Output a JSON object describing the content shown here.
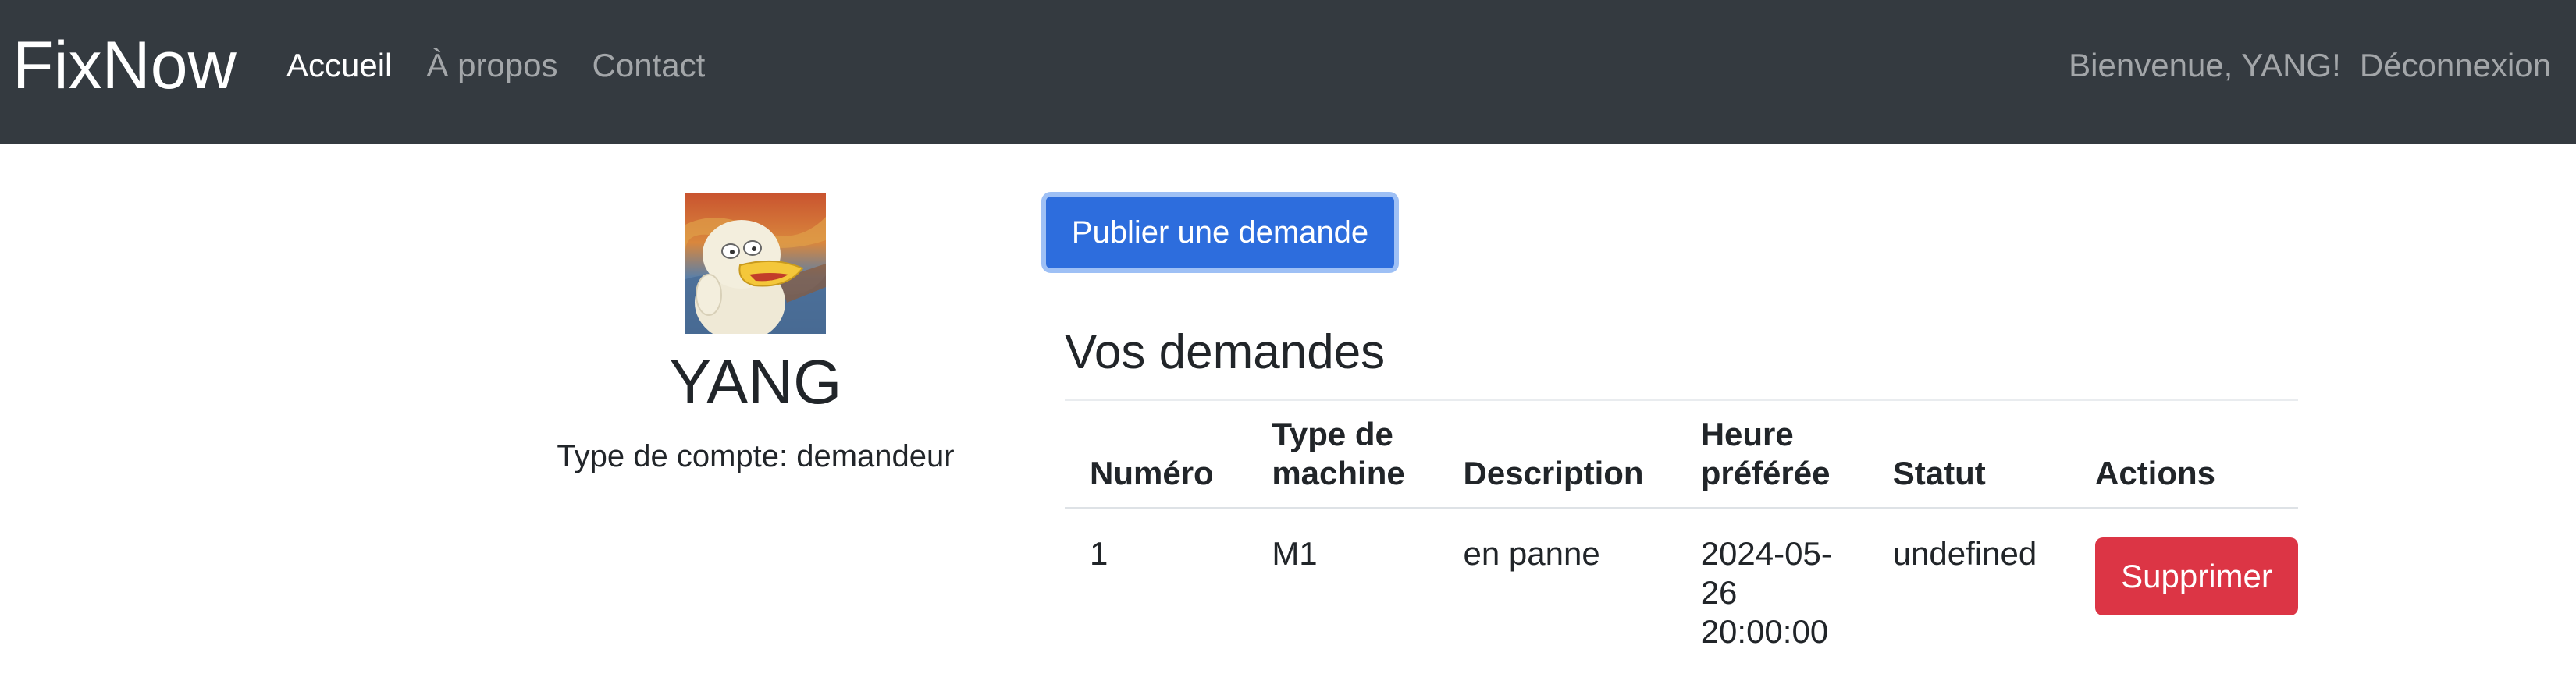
{
  "navbar": {
    "brand": "FixNow",
    "links": [
      {
        "label": "Accueil",
        "active": true
      },
      {
        "label": "À propos",
        "active": false
      },
      {
        "label": "Contact",
        "active": false
      }
    ],
    "welcome": "Bienvenue, YANG!",
    "logout": "Déconnexion"
  },
  "profile": {
    "name": "YANG",
    "account_type": "Type de compte: demandeur"
  },
  "main": {
    "publish_button": "Publier une demande",
    "section_title": "Vos demandes",
    "table": {
      "headers": [
        "Numéro",
        "Type de machine",
        "Description",
        "Heure préférée",
        "Statut",
        "Actions"
      ],
      "rows": [
        {
          "numero": "1",
          "type": "M1",
          "description": "en panne",
          "heure": "2024-05-26 20:00:00",
          "statut": "undefined",
          "action_label": "Supprimer"
        }
      ]
    }
  },
  "colors": {
    "navbar_bg": "#343a40",
    "primary": "#2d6ddd",
    "danger": "#dc3545"
  }
}
